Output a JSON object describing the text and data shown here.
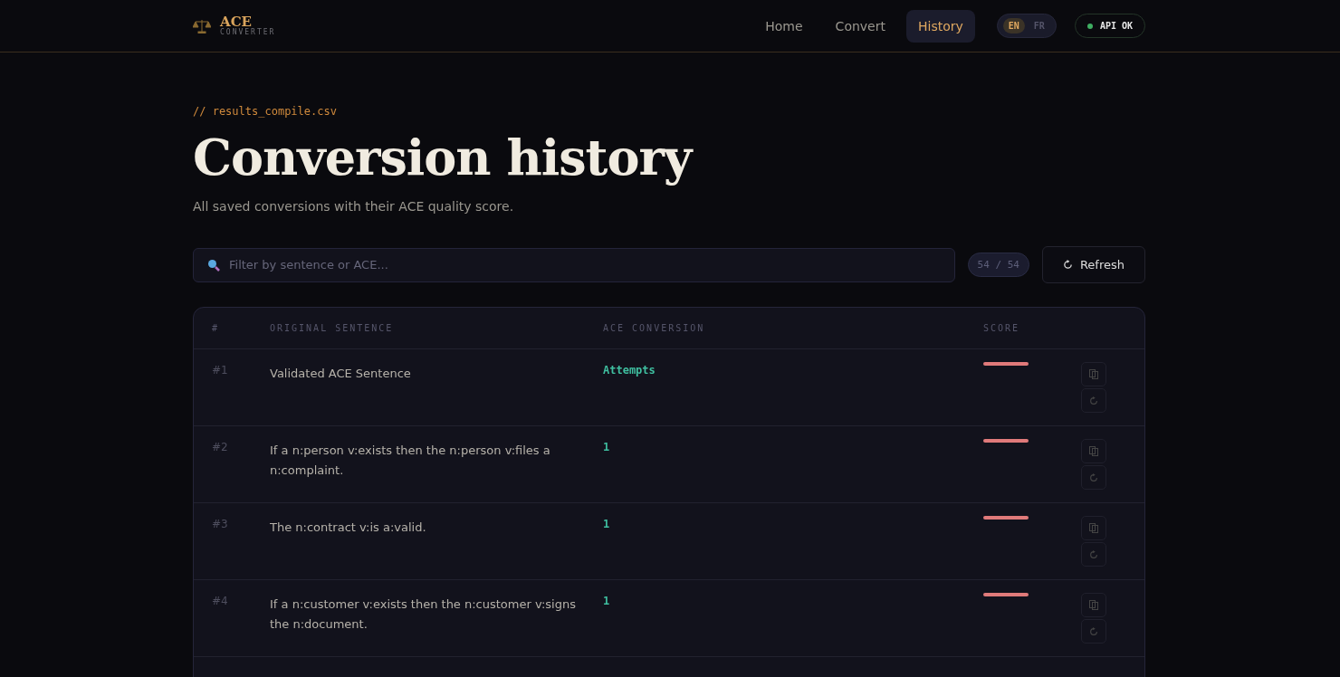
{
  "brand": {
    "title": "ACE",
    "subtitle": "CONVERTER"
  },
  "nav": [
    {
      "label": "Home",
      "selected": false
    },
    {
      "label": "Convert",
      "selected": false
    },
    {
      "label": "History",
      "selected": true
    }
  ],
  "languages": [
    {
      "label": "EN",
      "selected": true
    },
    {
      "label": "FR",
      "selected": false
    }
  ],
  "api_status": {
    "label": "API OK",
    "on": true
  },
  "file_tag": "// results_compile.csv",
  "title": "Conversion history",
  "subtitle": "All saved conversions with their ACE quality score.",
  "search": {
    "placeholder": "Filter by sentence or ACE..."
  },
  "count": "54 / 54",
  "refresh_button": "Refresh",
  "table": {
    "columns": [
      "#",
      "ORIGINAL SENTENCE",
      "ACE CONVERSION",
      "SCORE"
    ],
    "rows": [
      {
        "index": "#1",
        "sentence": "Validated ACE Sentence",
        "ace": "Attempts"
      },
      {
        "index": "#2",
        "sentence": "If a n:person v:exists then the n:person v:files a n:complaint.",
        "ace": "1"
      },
      {
        "index": "#3",
        "sentence": "The n:contract v:is a:valid.",
        "ace": "1"
      },
      {
        "index": "#4",
        "sentence": "If a n:customer v:exists then the n:customer v:signs the n:document.",
        "ace": "1"
      }
    ]
  }
}
